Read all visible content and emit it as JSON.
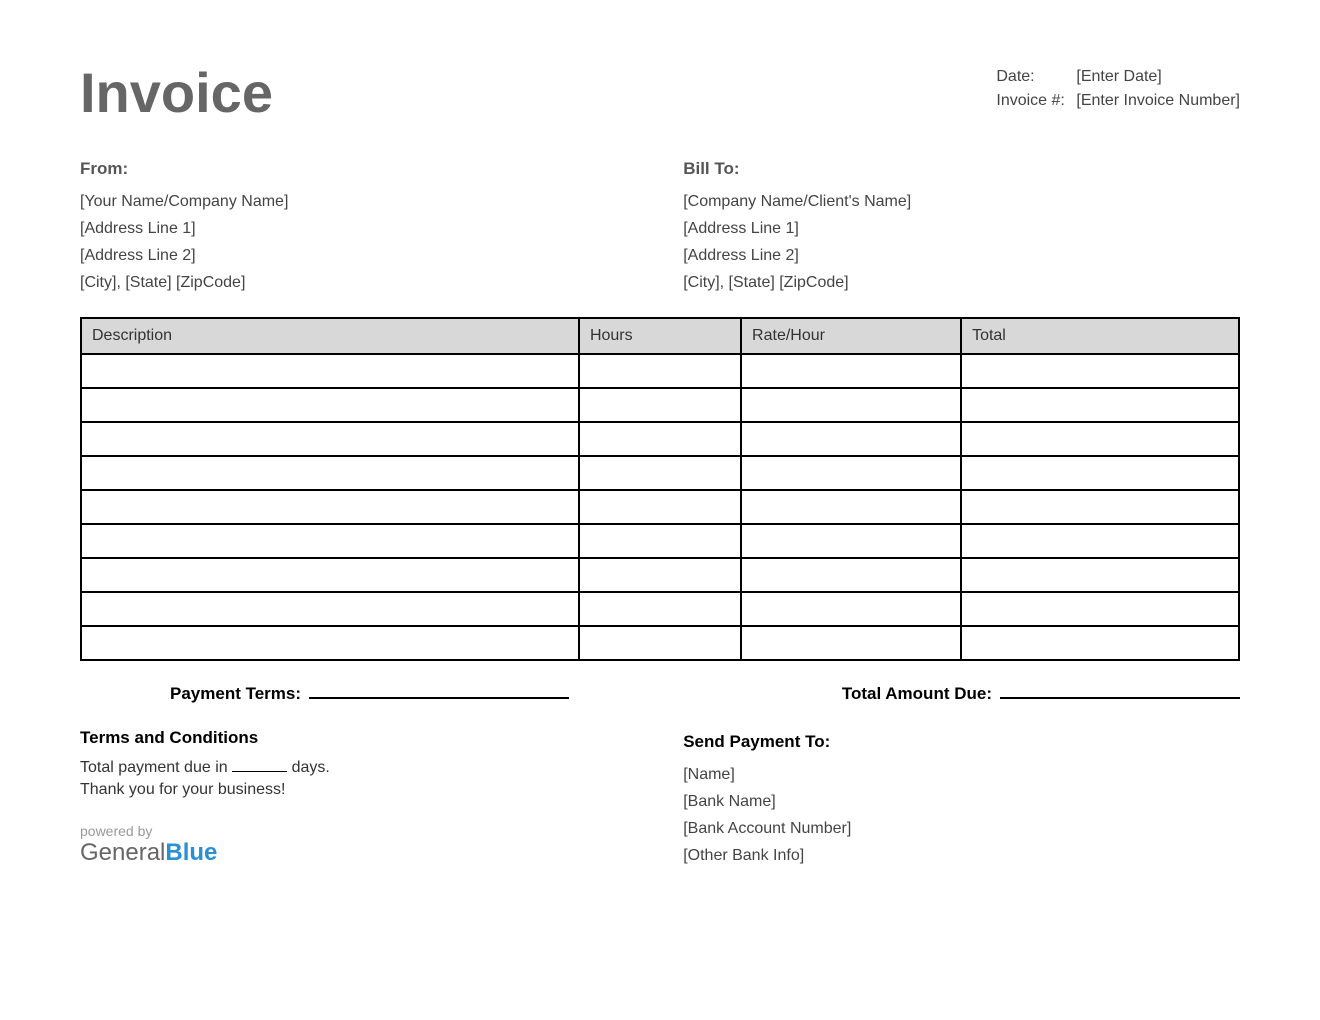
{
  "title": "Invoice",
  "meta": {
    "date_label": "Date:",
    "date_value": "[Enter Date]",
    "invoice_label": "Invoice #:",
    "invoice_value": "[Enter Invoice Number]"
  },
  "from": {
    "heading": "From:",
    "name": "[Your Name/Company Name]",
    "addr1": "[Address Line 1]",
    "addr2": "[Address Line 2]",
    "city": "[City], [State] [ZipCode]"
  },
  "billto": {
    "heading": "Bill To:",
    "name": "[Company Name/Client's Name]",
    "addr1": "[Address Line 1]",
    "addr2": "[Address Line 2]",
    "city": "[City], [State] [ZipCode]"
  },
  "table": {
    "headers": {
      "description": "Description",
      "hours": "Hours",
      "rate": "Rate/Hour",
      "total": "Total"
    },
    "row_count": 9
  },
  "summary": {
    "payment_terms_label": "Payment Terms:",
    "total_due_label": "Total Amount Due:"
  },
  "terms": {
    "heading": "Terms and Conditions",
    "line1_prefix": "Total payment due in",
    "line1_suffix": "days.",
    "line2": "Thank you for your business!"
  },
  "payment": {
    "heading": "Send Payment To:",
    "name": "[Name]",
    "bank": "[Bank Name]",
    "account": "[Bank Account Number]",
    "other": "[Other Bank Info]"
  },
  "branding": {
    "powered": "powered by",
    "general": "General",
    "blue": "Blue"
  }
}
